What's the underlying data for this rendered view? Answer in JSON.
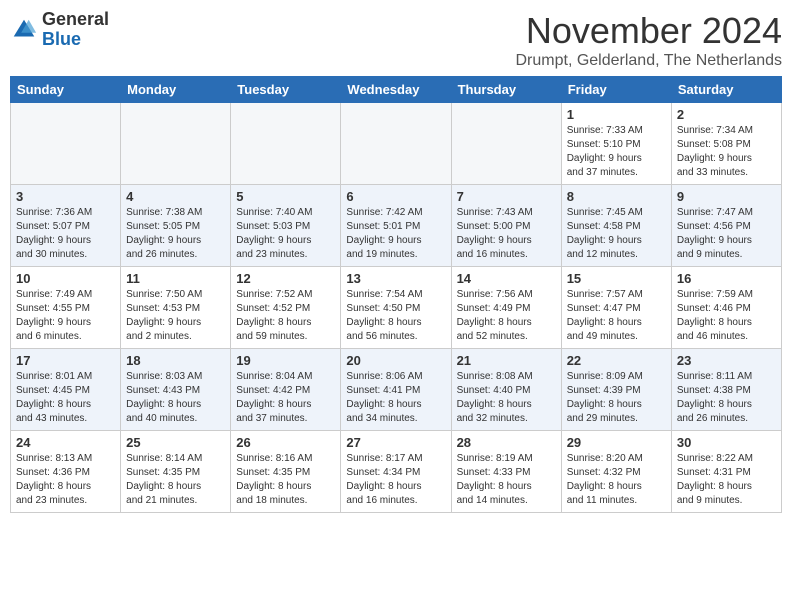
{
  "logo": {
    "general": "General",
    "blue": "Blue"
  },
  "header": {
    "month": "November 2024",
    "location": "Drumpt, Gelderland, The Netherlands"
  },
  "weekdays": [
    "Sunday",
    "Monday",
    "Tuesday",
    "Wednesday",
    "Thursday",
    "Friday",
    "Saturday"
  ],
  "weeks": [
    [
      {
        "day": "",
        "info": ""
      },
      {
        "day": "",
        "info": ""
      },
      {
        "day": "",
        "info": ""
      },
      {
        "day": "",
        "info": ""
      },
      {
        "day": "",
        "info": ""
      },
      {
        "day": "1",
        "info": "Sunrise: 7:33 AM\nSunset: 5:10 PM\nDaylight: 9 hours\nand 37 minutes."
      },
      {
        "day": "2",
        "info": "Sunrise: 7:34 AM\nSunset: 5:08 PM\nDaylight: 9 hours\nand 33 minutes."
      }
    ],
    [
      {
        "day": "3",
        "info": "Sunrise: 7:36 AM\nSunset: 5:07 PM\nDaylight: 9 hours\nand 30 minutes."
      },
      {
        "day": "4",
        "info": "Sunrise: 7:38 AM\nSunset: 5:05 PM\nDaylight: 9 hours\nand 26 minutes."
      },
      {
        "day": "5",
        "info": "Sunrise: 7:40 AM\nSunset: 5:03 PM\nDaylight: 9 hours\nand 23 minutes."
      },
      {
        "day": "6",
        "info": "Sunrise: 7:42 AM\nSunset: 5:01 PM\nDaylight: 9 hours\nand 19 minutes."
      },
      {
        "day": "7",
        "info": "Sunrise: 7:43 AM\nSunset: 5:00 PM\nDaylight: 9 hours\nand 16 minutes."
      },
      {
        "day": "8",
        "info": "Sunrise: 7:45 AM\nSunset: 4:58 PM\nDaylight: 9 hours\nand 12 minutes."
      },
      {
        "day": "9",
        "info": "Sunrise: 7:47 AM\nSunset: 4:56 PM\nDaylight: 9 hours\nand 9 minutes."
      }
    ],
    [
      {
        "day": "10",
        "info": "Sunrise: 7:49 AM\nSunset: 4:55 PM\nDaylight: 9 hours\nand 6 minutes."
      },
      {
        "day": "11",
        "info": "Sunrise: 7:50 AM\nSunset: 4:53 PM\nDaylight: 9 hours\nand 2 minutes."
      },
      {
        "day": "12",
        "info": "Sunrise: 7:52 AM\nSunset: 4:52 PM\nDaylight: 8 hours\nand 59 minutes."
      },
      {
        "day": "13",
        "info": "Sunrise: 7:54 AM\nSunset: 4:50 PM\nDaylight: 8 hours\nand 56 minutes."
      },
      {
        "day": "14",
        "info": "Sunrise: 7:56 AM\nSunset: 4:49 PM\nDaylight: 8 hours\nand 52 minutes."
      },
      {
        "day": "15",
        "info": "Sunrise: 7:57 AM\nSunset: 4:47 PM\nDaylight: 8 hours\nand 49 minutes."
      },
      {
        "day": "16",
        "info": "Sunrise: 7:59 AM\nSunset: 4:46 PM\nDaylight: 8 hours\nand 46 minutes."
      }
    ],
    [
      {
        "day": "17",
        "info": "Sunrise: 8:01 AM\nSunset: 4:45 PM\nDaylight: 8 hours\nand 43 minutes."
      },
      {
        "day": "18",
        "info": "Sunrise: 8:03 AM\nSunset: 4:43 PM\nDaylight: 8 hours\nand 40 minutes."
      },
      {
        "day": "19",
        "info": "Sunrise: 8:04 AM\nSunset: 4:42 PM\nDaylight: 8 hours\nand 37 minutes."
      },
      {
        "day": "20",
        "info": "Sunrise: 8:06 AM\nSunset: 4:41 PM\nDaylight: 8 hours\nand 34 minutes."
      },
      {
        "day": "21",
        "info": "Sunrise: 8:08 AM\nSunset: 4:40 PM\nDaylight: 8 hours\nand 32 minutes."
      },
      {
        "day": "22",
        "info": "Sunrise: 8:09 AM\nSunset: 4:39 PM\nDaylight: 8 hours\nand 29 minutes."
      },
      {
        "day": "23",
        "info": "Sunrise: 8:11 AM\nSunset: 4:38 PM\nDaylight: 8 hours\nand 26 minutes."
      }
    ],
    [
      {
        "day": "24",
        "info": "Sunrise: 8:13 AM\nSunset: 4:36 PM\nDaylight: 8 hours\nand 23 minutes."
      },
      {
        "day": "25",
        "info": "Sunrise: 8:14 AM\nSunset: 4:35 PM\nDaylight: 8 hours\nand 21 minutes."
      },
      {
        "day": "26",
        "info": "Sunrise: 8:16 AM\nSunset: 4:35 PM\nDaylight: 8 hours\nand 18 minutes."
      },
      {
        "day": "27",
        "info": "Sunrise: 8:17 AM\nSunset: 4:34 PM\nDaylight: 8 hours\nand 16 minutes."
      },
      {
        "day": "28",
        "info": "Sunrise: 8:19 AM\nSunset: 4:33 PM\nDaylight: 8 hours\nand 14 minutes."
      },
      {
        "day": "29",
        "info": "Sunrise: 8:20 AM\nSunset: 4:32 PM\nDaylight: 8 hours\nand 11 minutes."
      },
      {
        "day": "30",
        "info": "Sunrise: 8:22 AM\nSunset: 4:31 PM\nDaylight: 8 hours\nand 9 minutes."
      }
    ]
  ],
  "row_colors": [
    "#ffffff",
    "#eef3fa",
    "#ffffff",
    "#eef3fa",
    "#ffffff"
  ]
}
